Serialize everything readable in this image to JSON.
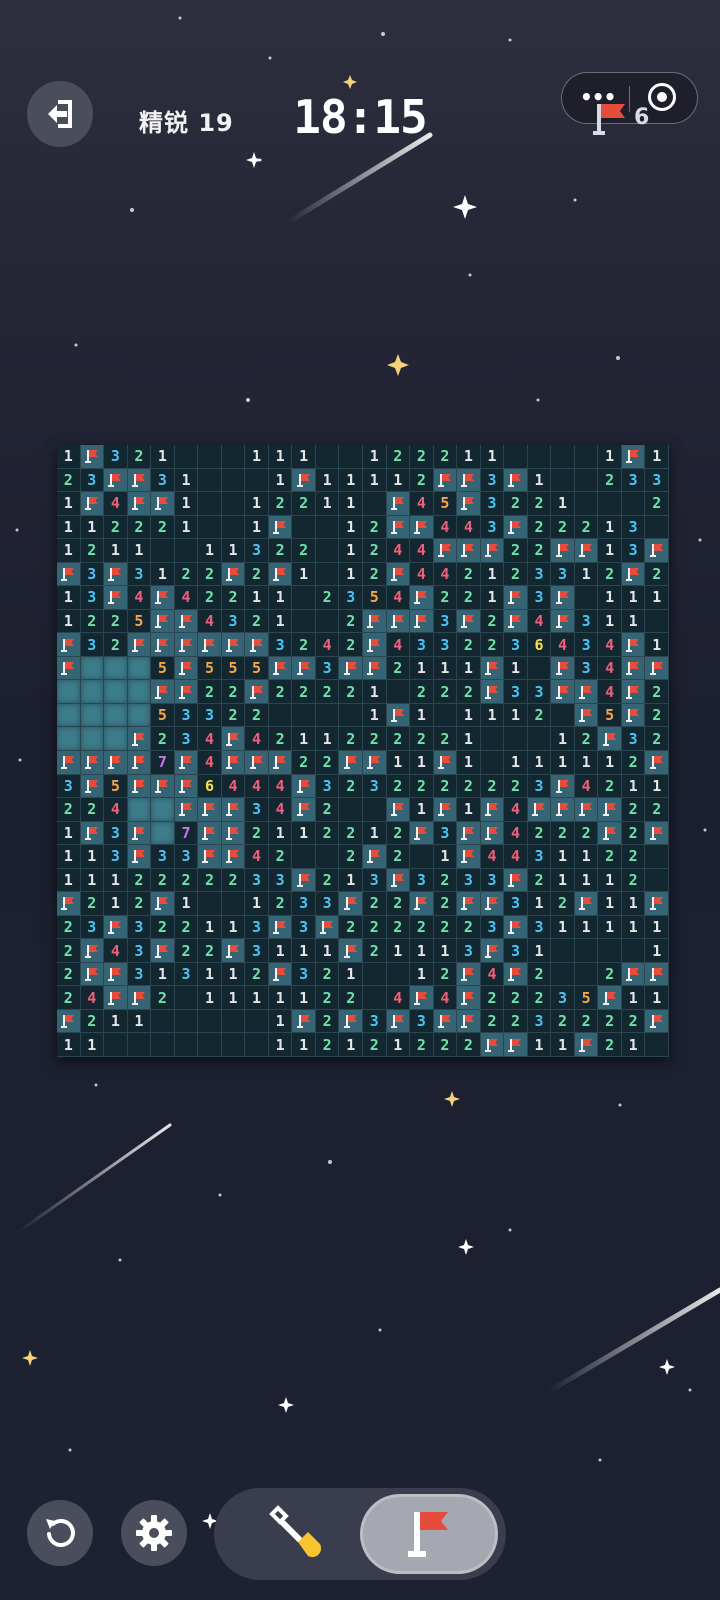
{
  "header": {
    "level_label": "精锐 19",
    "timer": "18:15",
    "flags_remaining": "6",
    "menu_dots": "•••"
  },
  "icons": {
    "exit": "exit-icon",
    "flag": "flag-icon",
    "target": "target-icon",
    "undo": "undo-icon",
    "settings": "gear-icon",
    "dig": "shovel-icon"
  },
  "colors": {
    "number_1": "#e6e6e6",
    "number_2": "#6ee2a8",
    "number_3": "#4bc4f5",
    "number_4": "#f0607a",
    "number_5": "#f6a64a",
    "number_6": "#f5e14c",
    "number_7": "#c876f2",
    "flag_red": "#e54c3c"
  },
  "board": {
    "rows": 26,
    "cols": 26,
    "legend": {
      "0-8": "revealed count (0 = empty)",
      "F": "flagged",
      "H": "unrevealed"
    },
    "grid": [
      "1F3210001110012221100001F1",
      "23FF310001F11112FF3F100233",
      "1F4FF100122110F45F32210002FF",
      "112221001F0012FF443F222130F4",
      "1211001132201244FFF22FF13F3",
      "F3F3122F2F1012F442123312F2",
      "13F4F4221102354F221F3F0111",
      "1225FF4321002FFF3F2F4F3110",
      "F32FFFFFF3242F4332236434F1",
      "FHHH5F555FF3FF2111F10F34FF3311",
      "HHHHFF22F222210222F33FF4F2",
      "HHHH5332200001F1011120F5F2",
      "HHHF234F421122222100012F32",
      "FFFF7F4FFF22FF11F10111112F",
      "3F5FFF6444F3232222223F4211",
      "224HHFFF34F200F1F1F4FFFF22",
      "1F3FH7FF2112212F3FF4222F2F",
      "113F33FF42002F201F4431122",
      "1112222233F213F3233F21112",
      "F212F1001233F22F2FF312F11FF",
      "23F322113F3F2222223F3111111F",
      "2F43F22F3111F21113F31000011",
      "2FF313112F3210012F4F2002FF2111",
      "24FF20111112204F4F22235F1112F",
      "F211000001F2F3F3FF2232222F21",
      "110000000112121222FF11F21"
    ]
  }
}
